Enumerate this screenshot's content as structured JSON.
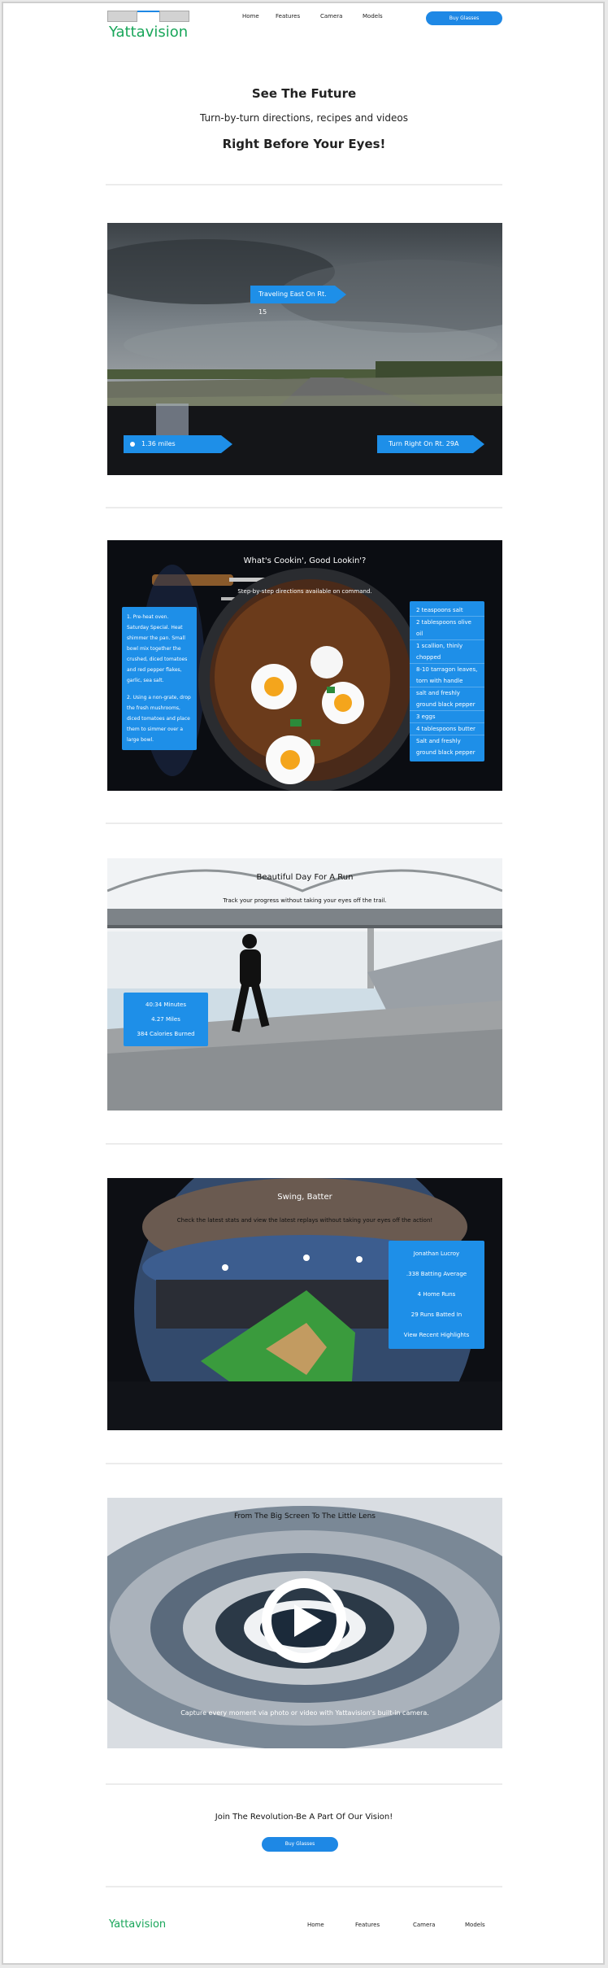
{
  "header": {
    "logo": "Yattavision",
    "nav": [
      "Home",
      "Features",
      "Camera",
      "Models"
    ],
    "cta": "Buy Glasses"
  },
  "hero": {
    "line1": "See The Future",
    "line2": "Turn-by-turn directions, recipes and videos",
    "line3": "Right Before Your Eyes!"
  },
  "directions": {
    "top_label": "Traveling East On Rt. 15",
    "distance": "1.36 miles",
    "turn": "Turn Right On Rt. 29A"
  },
  "recipe": {
    "title": "What's Cookin', Good Lookin'?",
    "subtitle": "Step-by-step directions available on command.",
    "steps": [
      "1. Pre-heat oven. Saturday Special. Heat shimmer the pan. Small bowl mix together the crushed, diced tomatoes and red pepper flakes, garlic, sea salt.",
      "2. Using a non-grate, drop the fresh mushrooms, diced tomatoes and place them to simmer over a large bowl."
    ],
    "ingredients": [
      "2 teaspoons salt",
      "2 tablespoons olive oil",
      "1 scallion, thinly chopped",
      "8-10 tarragon leaves, torn with handle",
      "salt and freshly ground black pepper",
      "3 eggs",
      "4 tablespoons butter",
      "Salt and freshly ground black pepper"
    ]
  },
  "run": {
    "title": "Beautiful Day For A Run",
    "subtitle": "Track your progress without taking your eyes off the trail.",
    "stats": [
      "40:34 Minutes",
      "4.27 Miles",
      "384 Calories Burned"
    ]
  },
  "baseball": {
    "title": "Swing, Batter",
    "subtitle": "Check the latest stats and view the latest replays without taking your eyes off the action!",
    "stats": [
      "Jonathan Lucroy",
      ".338 Batting Average",
      "4 Home Runs",
      "29 Runs Batted In",
      "View Recent Highlights"
    ]
  },
  "camera": {
    "title": "From The Big Screen To The Little Lens",
    "caption": "Capture every moment via photo or video with Yattavision's built-in camera."
  },
  "cta": {
    "text": "Join The Revolution-Be A Part Of Our Vision!",
    "button": "Buy Glasses"
  },
  "footer": {
    "logo": "Yattavision",
    "nav": [
      "Home",
      "Features",
      "Camera",
      "Models"
    ]
  },
  "colors": {
    "accent": "#1e88e5",
    "brand": "#19a65a"
  }
}
